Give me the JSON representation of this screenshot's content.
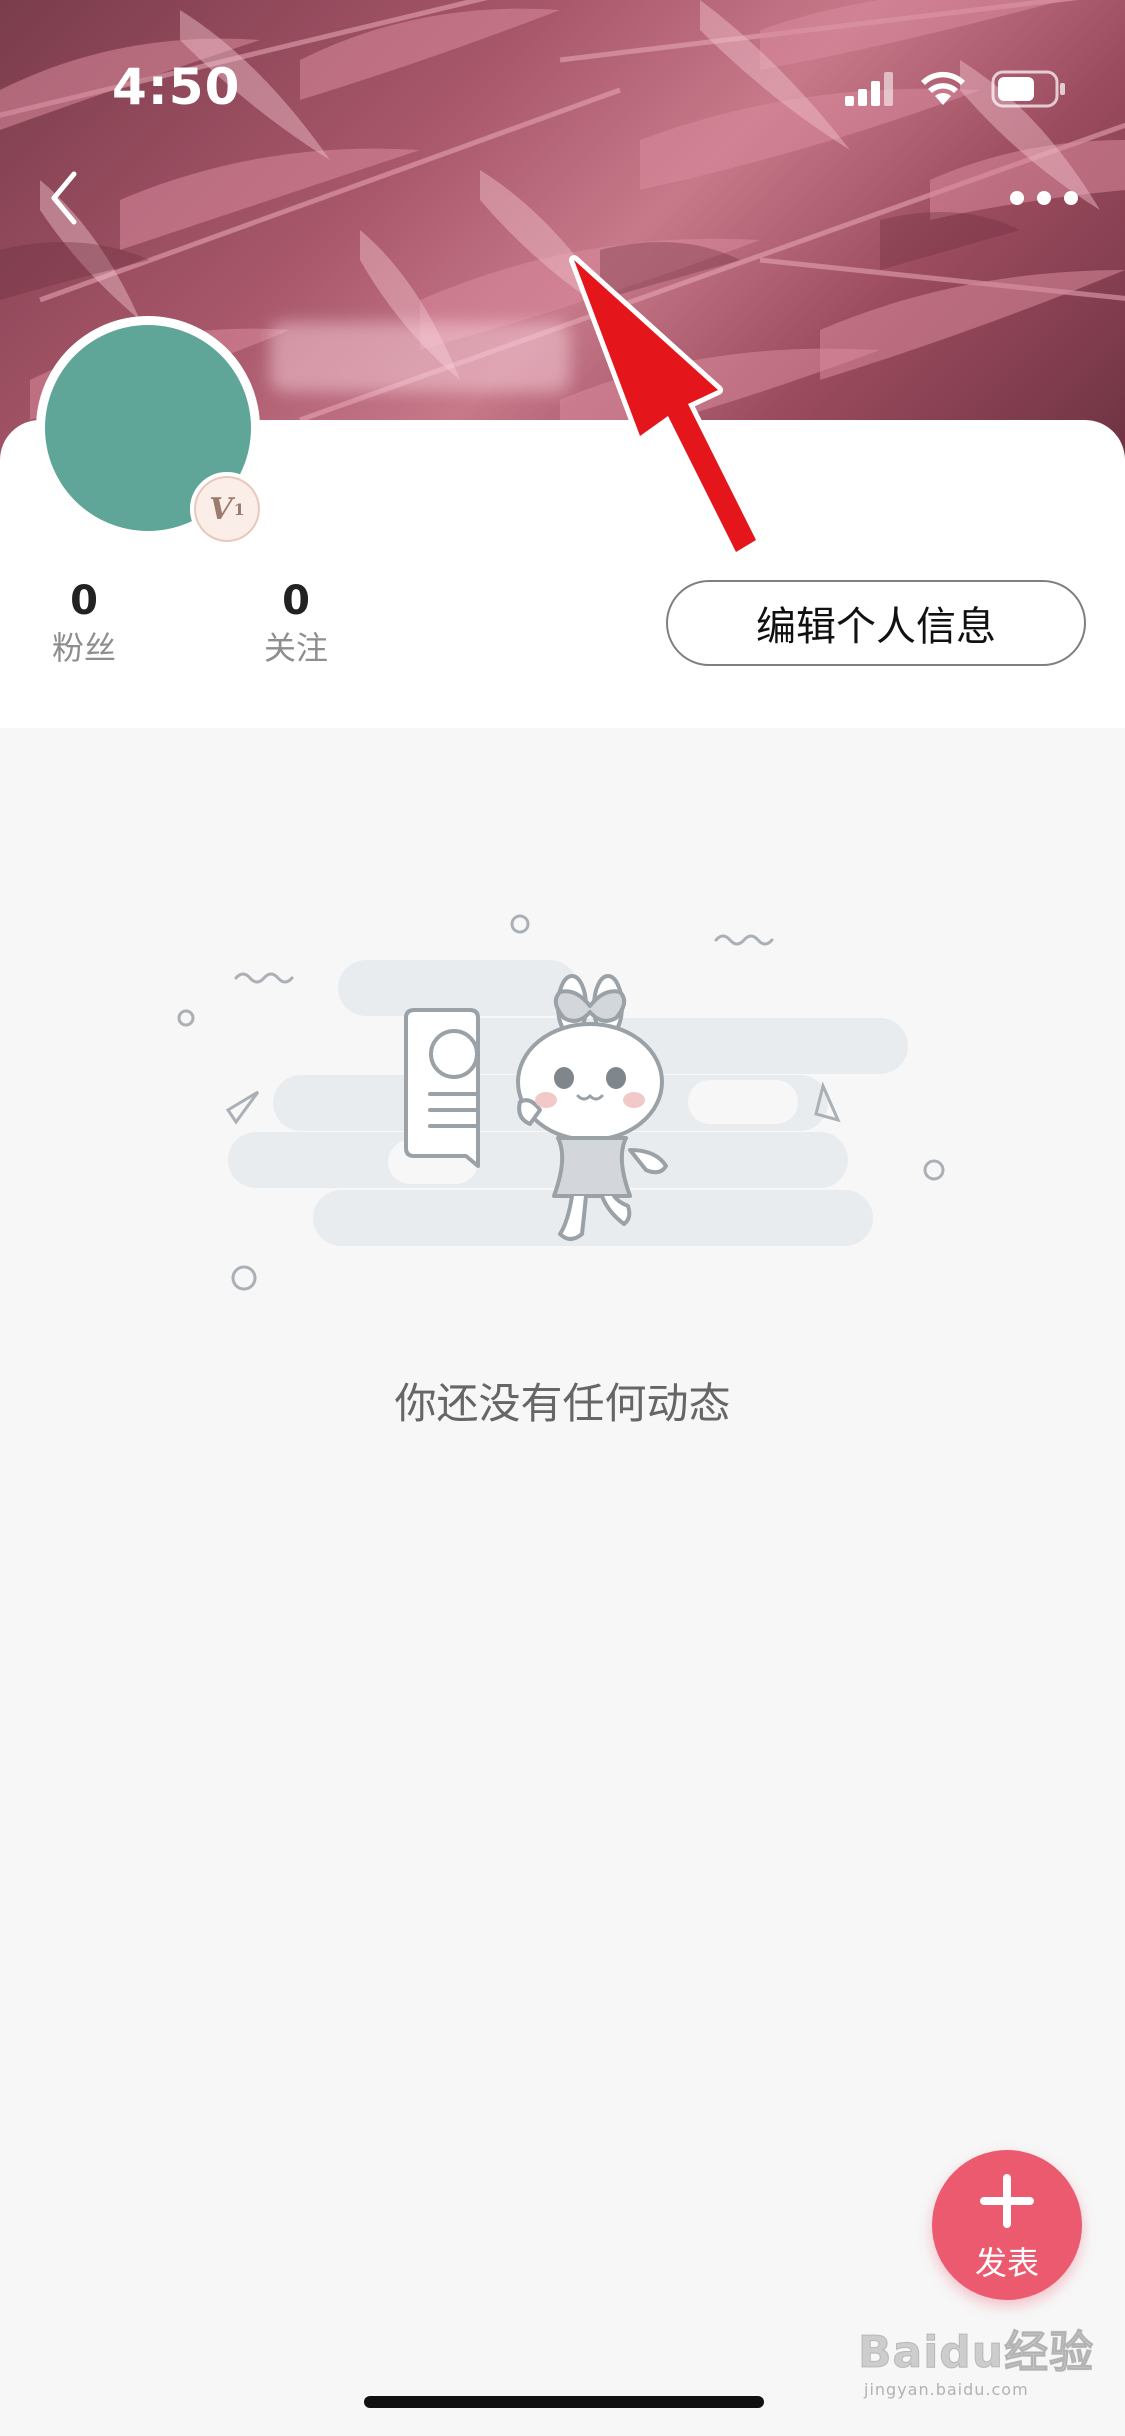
{
  "status_bar": {
    "time": "4:50",
    "icons": [
      "cellular-signal-icon",
      "wifi-icon",
      "battery-icon"
    ]
  },
  "nav": {
    "back_icon": "chevron-left-icon",
    "more_icon": "more-dots-icon"
  },
  "profile": {
    "avatar_color": "#5fa699",
    "user_name": "",
    "level_badge": {
      "letter": "V",
      "number": "1"
    },
    "stats": [
      {
        "value": "0",
        "label": "粉丝"
      },
      {
        "value": "0",
        "label": "关注"
      }
    ],
    "edit_button_label": "编辑个人信息"
  },
  "feed": {
    "empty_text": "你还没有任何动态"
  },
  "fab": {
    "icon": "plus-icon",
    "label": "发表",
    "color": "#ec5a6f"
  },
  "watermark": {
    "brand": "Baidu经验",
    "domain": "jingyan.baidu.com"
  },
  "colors": {
    "accent": "#ec5a6f",
    "annotation_arrow": "#e5161b",
    "background": "#f7f7f7"
  }
}
